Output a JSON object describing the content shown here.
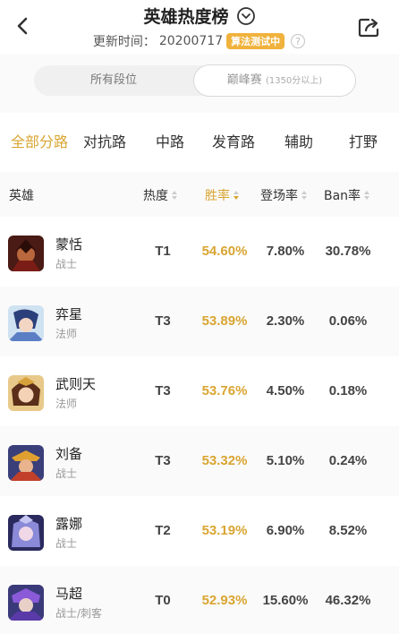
{
  "header": {
    "title": "英雄热度榜",
    "update_label": "更新时间：",
    "update_date": "20200717",
    "algo_badge": "算法测试中"
  },
  "rank_segment": {
    "all_label": "所有段位",
    "peak_label": "巅峰赛",
    "peak_sub": "(1350分以上)"
  },
  "lanes": [
    {
      "label": "全部分路",
      "active": true
    },
    {
      "label": "对抗路",
      "active": false
    },
    {
      "label": "中路",
      "active": false
    },
    {
      "label": "发育路",
      "active": false
    },
    {
      "label": "辅助",
      "active": false
    },
    {
      "label": "打野",
      "active": false
    }
  ],
  "columns": {
    "hero": "英雄",
    "heat": "热度",
    "win": "胜率",
    "pick": "登场率",
    "ban": "Ban率"
  },
  "heroes": [
    {
      "name": "蒙恬",
      "role": "战士",
      "heat": "T1",
      "win": "54.60%",
      "pick": "7.80%",
      "ban": "30.78%"
    },
    {
      "name": "弈星",
      "role": "法师",
      "heat": "T3",
      "win": "53.89%",
      "pick": "2.30%",
      "ban": "0.06%"
    },
    {
      "name": "武则天",
      "role": "法师",
      "heat": "T3",
      "win": "53.76%",
      "pick": "4.50%",
      "ban": "0.18%"
    },
    {
      "name": "刘备",
      "role": "战士",
      "heat": "T3",
      "win": "53.32%",
      "pick": "5.10%",
      "ban": "0.24%"
    },
    {
      "name": "露娜",
      "role": "战士",
      "heat": "T2",
      "win": "53.19%",
      "pick": "6.90%",
      "ban": "8.52%"
    },
    {
      "name": "马超",
      "role": "战士/刺客",
      "heat": "T0",
      "win": "52.93%",
      "pick": "15.60%",
      "ban": "46.32%"
    }
  ],
  "colors": {
    "accent": "#d9a532",
    "badge": "#f0b23c"
  },
  "icons": {
    "back": "chevron-left-icon",
    "dropdown": "chevron-down-circle-icon",
    "help": "question-circle-icon",
    "share": "share-icon"
  }
}
